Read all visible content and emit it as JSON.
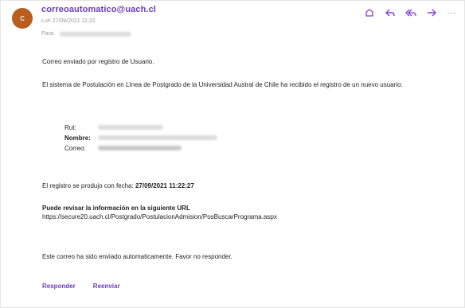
{
  "header": {
    "avatar_letter": "c",
    "sender": "correoautomatico@uach.cl",
    "date": "Lun 27/09/2021 11:22",
    "to_label": "Para:"
  },
  "message": {
    "intro": "Correo enviado por registro de Usuario.",
    "paragraph": "El sistema de Postulación en Línea de Postgrado de la Universidad Austral de Chile ha recibido el registro de un nuevo usuario:",
    "fields": [
      {
        "label": "Rut:"
      },
      {
        "label": "Nombre:"
      },
      {
        "label": "Correo:"
      }
    ],
    "registered_prefix": "El registro se produjo con fecha:",
    "registered_date": "27/09/2021 11:22:27",
    "review_label": "Puede revisar la información en la siguiente URL",
    "url": "https://secure20.uach.cl/Postgrado/PostulacionAdmision/PosBuscarPrograma.aspx",
    "footer": "Este correo ha sido enviado automaticamente. Favor no responder."
  },
  "actions": {
    "reply": "Responder",
    "forward": "Reenviar"
  },
  "colors": {
    "accent": "#6a3dbf",
    "avatar": "#b85e1e"
  },
  "icons": [
    "sticker-icon",
    "reply-icon",
    "reply-all-icon",
    "forward-icon",
    "more-icon"
  ]
}
